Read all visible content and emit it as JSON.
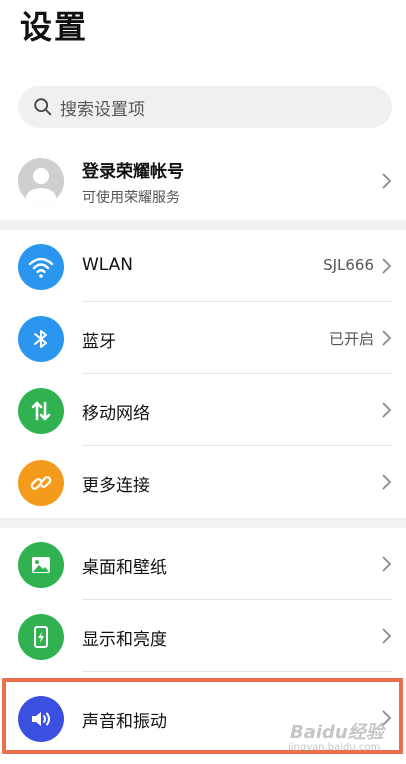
{
  "header": {
    "title": "设置"
  },
  "search": {
    "placeholder": "搜索设置项"
  },
  "account": {
    "title": "登录荣耀帐号",
    "subtitle": "可使用荣耀服务"
  },
  "groups": [
    {
      "items": [
        {
          "key": "wlan",
          "label": "WLAN",
          "value": "SJL666",
          "icon": "wifi-icon",
          "color": "#2a96f0"
        },
        {
          "key": "bluetooth",
          "label": "蓝牙",
          "value": "已开启",
          "icon": "bluetooth-icon",
          "color": "#2a96f0"
        },
        {
          "key": "mobile-network",
          "label": "移动网络",
          "value": "",
          "icon": "mobile-data-icon",
          "color": "#2fb24f"
        },
        {
          "key": "more-connections",
          "label": "更多连接",
          "value": "",
          "icon": "link-icon",
          "color": "#f59b1c"
        }
      ]
    },
    {
      "items": [
        {
          "key": "wallpaper",
          "label": "桌面和壁纸",
          "value": "",
          "icon": "image-icon",
          "color": "#2fb24f"
        },
        {
          "key": "display",
          "label": "显示和亮度",
          "value": "",
          "icon": "display-icon",
          "color": "#2fb24f"
        },
        {
          "key": "sound",
          "label": "声音和振动",
          "value": "",
          "icon": "speaker-icon",
          "color": "#3b4fe0"
        }
      ]
    }
  ],
  "colors": {
    "highlight": "#e9714f",
    "chevron": "#8a8a8a",
    "gap": "#f2f2f2"
  },
  "watermark": {
    "brand": "Baidu经验",
    "url": "jingyan.baidu.com"
  }
}
